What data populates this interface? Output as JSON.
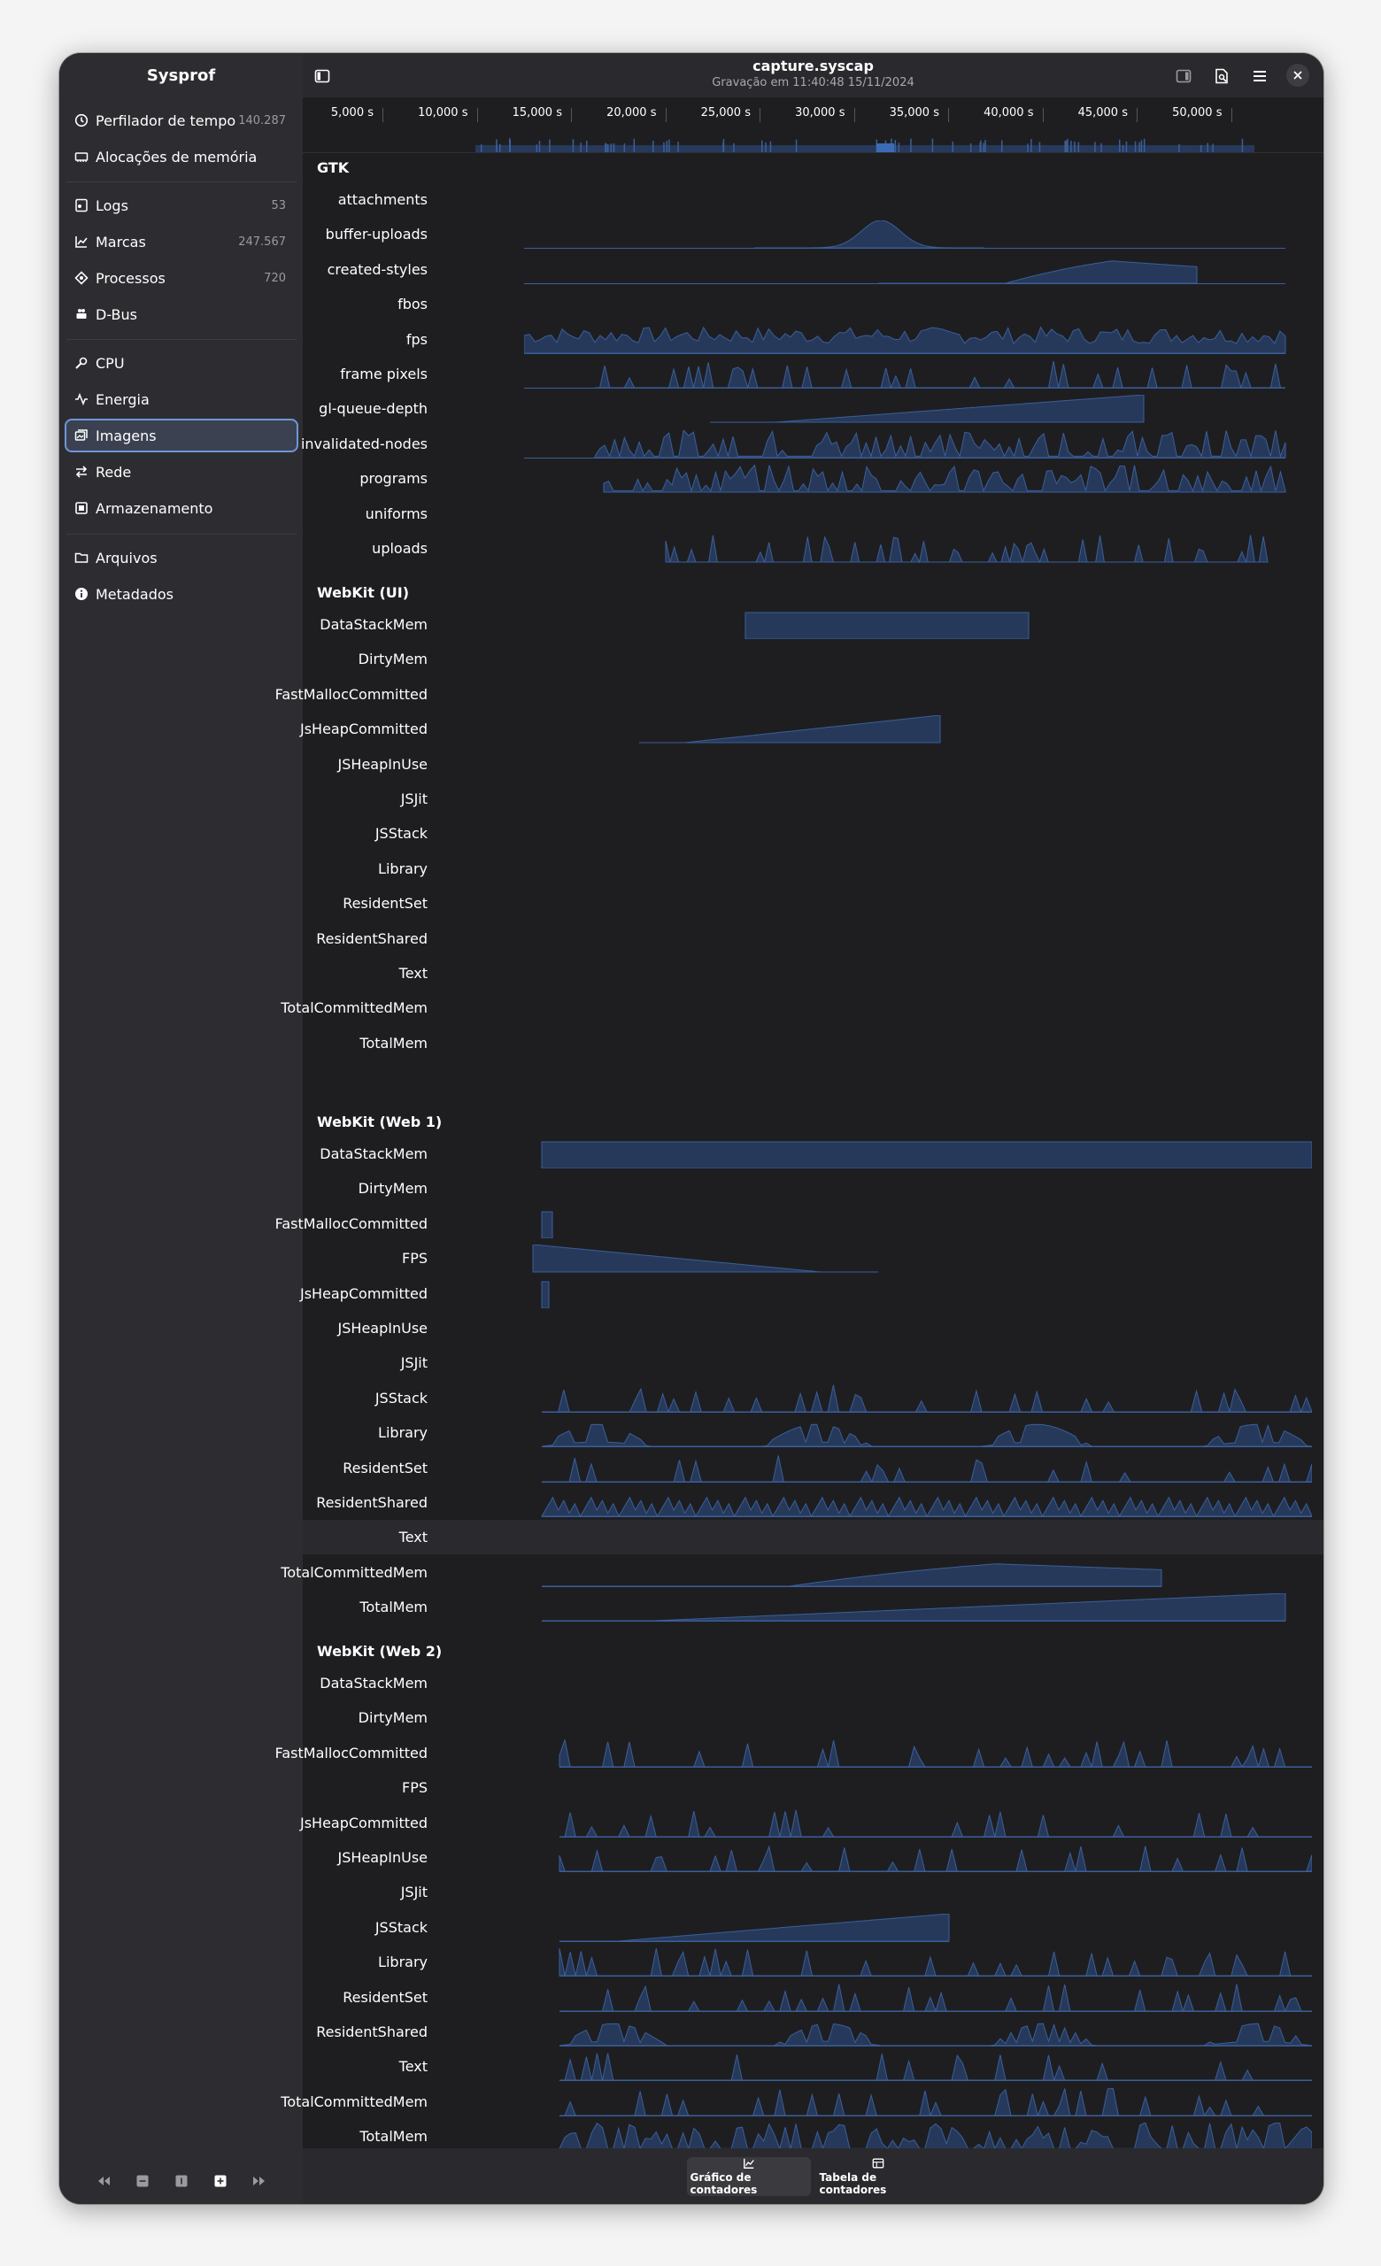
{
  "app": {
    "name": "Sysprof",
    "title": "capture.syscap",
    "subtitle": "Gravação em 11:40:48 15/11/2024"
  },
  "sidebar": {
    "items": [
      {
        "label": "Perfilador de tempo",
        "count": "140.287",
        "icon": "clock-icon"
      },
      {
        "label": "Alocações de memória",
        "count": "",
        "icon": "memory-icon"
      },
      {
        "label": "Logs",
        "count": "53",
        "icon": "logs-icon"
      },
      {
        "label": "Marcas",
        "count": "247.567",
        "icon": "marks-icon"
      },
      {
        "label": "Processos",
        "count": "720",
        "icon": "processes-icon"
      },
      {
        "label": "D-Bus",
        "count": "",
        "icon": "dbus-icon"
      },
      {
        "label": "CPU",
        "count": "",
        "icon": "cpu-icon"
      },
      {
        "label": "Energia",
        "count": "",
        "icon": "energy-icon"
      },
      {
        "label": "Imagens",
        "count": "",
        "icon": "graphics-icon",
        "selected": true
      },
      {
        "label": "Rede",
        "count": "",
        "icon": "network-icon"
      },
      {
        "label": "Armazenamento",
        "count": "",
        "icon": "storage-icon"
      },
      {
        "label": "Arquivos",
        "count": "",
        "icon": "folder-icon"
      },
      {
        "label": "Metadados",
        "count": "",
        "icon": "info-icon"
      }
    ]
  },
  "ruler": {
    "ticks": [
      "5,000 s",
      "10,000 s",
      "15,000 s",
      "20,000 s",
      "25,000 s",
      "30,000 s",
      "35,000 s",
      "40,000 s",
      "45,000 s",
      "50,000 s"
    ]
  },
  "groups": [
    {
      "name": "GTK",
      "rows": [
        "attachments",
        "buffer-uploads",
        "created-styles",
        "fbos",
        "fps",
        "frame pixels",
        "gl-queue-depth",
        "invalidated-nodes",
        "programs",
        "uniforms",
        "uploads"
      ]
    },
    {
      "name": "WebKit (UI)",
      "rows": [
        "DataStackMem",
        "DirtyMem",
        "FastMallocCommitted",
        "JsHeapCommitted",
        "JSHeapInUse",
        "JSJit",
        "JSStack",
        "Library",
        "ResidentSet",
        "ResidentShared",
        "Text",
        "TotalCommittedMem",
        "TotalMem"
      ]
    },
    {
      "name": "WebKit (Web 1)",
      "rows": [
        "DataStackMem",
        "DirtyMem",
        "FastMallocCommitted",
        "FPS",
        "JsHeapCommitted",
        "JSHeapInUse",
        "JSJit",
        "JSStack",
        "Library",
        "ResidentSet",
        "ResidentShared",
        "Text",
        "TotalCommittedMem",
        "TotalMem"
      ]
    },
    {
      "name": "WebKit (Web 2)",
      "rows": [
        "DataStackMem",
        "DirtyMem",
        "FastMallocCommitted",
        "FPS",
        "JsHeapCommitted",
        "JSHeapInUse",
        "JSJit",
        "JSStack",
        "Library",
        "ResidentSet",
        "ResidentShared",
        "Text",
        "TotalCommittedMem",
        "TotalMem"
      ]
    }
  ],
  "footer": {
    "tabs": [
      {
        "label": "Gráfico de contadores",
        "active": true
      },
      {
        "label": "Tabela de contadores",
        "active": false
      }
    ]
  },
  "colors": {
    "accent": "#3d6bb3",
    "track_fill": "#27395a",
    "track_line": "#3a5f9a"
  }
}
